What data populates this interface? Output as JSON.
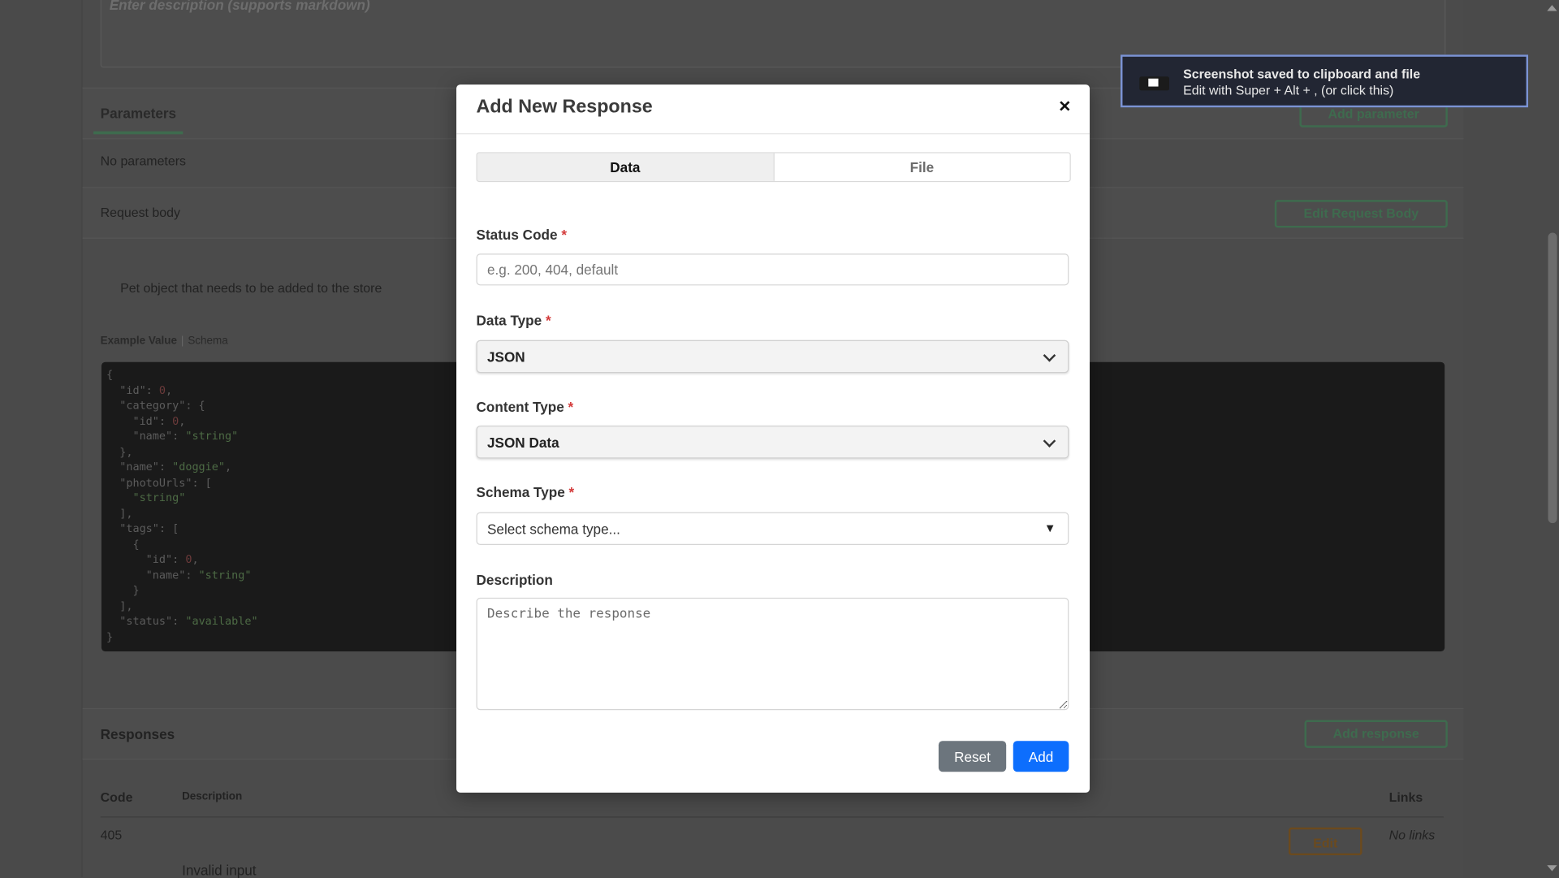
{
  "background": {
    "description_placeholder": "Enter description (supports markdown)",
    "parameters_tab": "Parameters",
    "add_parameter_label": "Add parameter",
    "no_parameters": "No parameters",
    "request_body_label": "Request body",
    "edit_request_body_label": "Edit Request Body",
    "body_description": "Pet object that needs to be added to the store",
    "example_value_tab": "Example Value",
    "schema_tab": "Schema",
    "responses_title": "Responses",
    "add_response_label": "Add response",
    "columns": {
      "code": "Code",
      "description": "Description",
      "links": "Links"
    },
    "rows": [
      {
        "code": "405",
        "description": "Invalid input",
        "edit_label": "Edit",
        "links": "No links"
      }
    ]
  },
  "modal": {
    "title": "Add New Response",
    "close_symbol": "×",
    "tabs": [
      {
        "label": "Data",
        "active": true
      },
      {
        "label": "File",
        "active": false
      }
    ],
    "status_code": {
      "label": "Status Code",
      "required_mark": "*",
      "placeholder": "e.g. 200, 404, default",
      "value": ""
    },
    "data_type": {
      "label": "Data Type",
      "required_mark": "*",
      "selected": "JSON"
    },
    "content_type": {
      "label": "Content Type",
      "required_mark": "*",
      "selected": "JSON Data"
    },
    "schema_type": {
      "label": "Schema Type",
      "required_mark": "*",
      "selected": "Select schema type...",
      "arrow": "▼"
    },
    "description": {
      "label": "Description",
      "placeholder": "Describe the response"
    },
    "reset_label": "Reset",
    "add_label": "Add"
  },
  "toast": {
    "title": "Screenshot saved to clipboard and file",
    "subtitle": "Edit with Super + Alt + , (or click this)"
  },
  "colors": {
    "primary": "#0d6efd",
    "secondary": "#6c757d",
    "required": "#d43b3b",
    "toast_border": "#7b93d4"
  }
}
